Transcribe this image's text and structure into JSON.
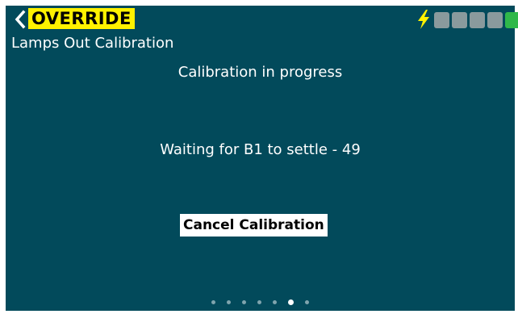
{
  "header": {
    "back_icon": "chevron-left-icon",
    "mode_badge": "OVERRIDE",
    "mode_badge_color": "#fff200",
    "page_title": "Lamps Out Calibration"
  },
  "status_bar": {
    "power_icon": "lightning-bolt-icon",
    "power_icon_color": "#fff200",
    "signal_bars": [
      {
        "state": "inactive",
        "color": "#8a9a9d"
      },
      {
        "state": "inactive",
        "color": "#8a9a9d"
      },
      {
        "state": "inactive",
        "color": "#8a9a9d"
      },
      {
        "state": "inactive",
        "color": "#8a9a9d"
      },
      {
        "state": "active",
        "color": "#2fb84a"
      }
    ]
  },
  "main": {
    "progress_text": "Calibration in progress",
    "waiting_text": "Waiting for B1 to settle - 49",
    "cancel_button_label": "Cancel Calibration"
  },
  "pager": {
    "page_count": 7,
    "active_index": 5
  },
  "colors": {
    "background": "#024a5b",
    "text": "#ffffff"
  }
}
